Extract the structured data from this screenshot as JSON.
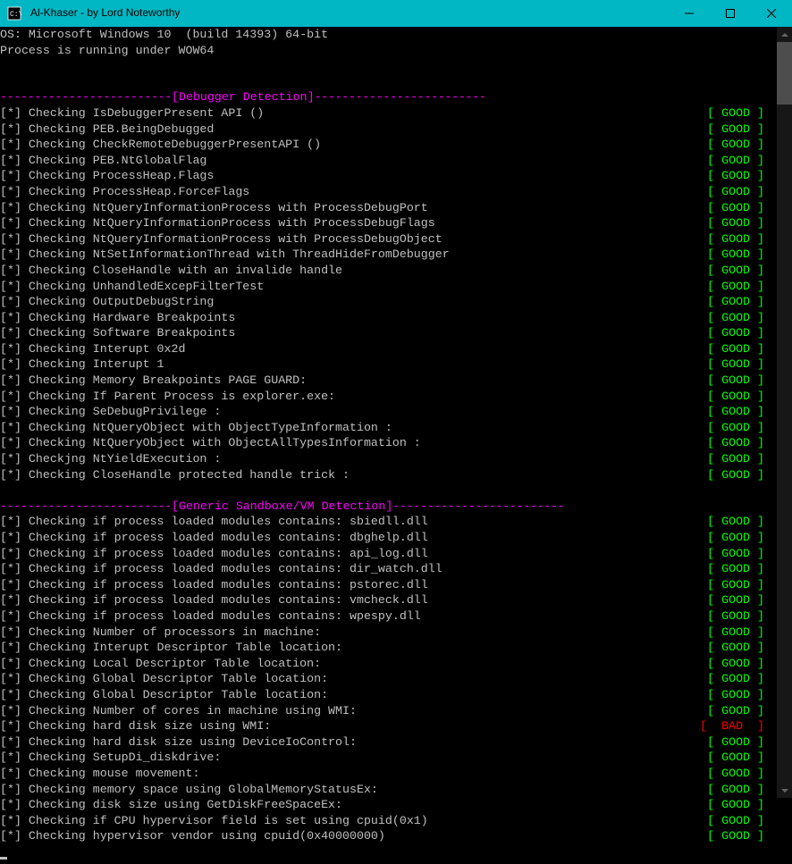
{
  "window": {
    "title": "Al-Khaser - by Lord Noteworthy"
  },
  "header_lines": [
    "OS: Microsoft Windows 10  (build 14393) 64-bit",
    "Process is running under WOW64"
  ],
  "sections": [
    {
      "title": "[Debugger Detection]",
      "dash_left": "-------------------------",
      "dash_right": "-------------------------",
      "items": [
        {
          "text": "Checking IsDebuggerPresent API ()",
          "status": "GOOD"
        },
        {
          "text": "Checking PEB.BeingDebugged",
          "status": "GOOD"
        },
        {
          "text": "Checking CheckRemoteDebuggerPresentAPI ()",
          "status": "GOOD"
        },
        {
          "text": "Checking PEB.NtGlobalFlag",
          "status": "GOOD"
        },
        {
          "text": "Checking ProcessHeap.Flags",
          "status": "GOOD"
        },
        {
          "text": "Checking ProcessHeap.ForceFlags",
          "status": "GOOD"
        },
        {
          "text": "Checking NtQueryInformationProcess with ProcessDebugPort",
          "status": "GOOD"
        },
        {
          "text": "Checking NtQueryInformationProcess with ProcessDebugFlags",
          "status": "GOOD"
        },
        {
          "text": "Checking NtQueryInformationProcess with ProcessDebugObject",
          "status": "GOOD"
        },
        {
          "text": "Checking NtSetInformationThread with ThreadHideFromDebugger",
          "status": "GOOD"
        },
        {
          "text": "Checking CloseHandle with an invalide handle",
          "status": "GOOD"
        },
        {
          "text": "Checking UnhandledExcepFilterTest",
          "status": "GOOD"
        },
        {
          "text": "Checking OutputDebugString",
          "status": "GOOD"
        },
        {
          "text": "Checking Hardware Breakpoints",
          "status": "GOOD"
        },
        {
          "text": "Checking Software Breakpoints",
          "status": "GOOD"
        },
        {
          "text": "Checking Interupt 0x2d",
          "status": "GOOD"
        },
        {
          "text": "Checking Interupt 1",
          "status": "GOOD"
        },
        {
          "text": "Checking Memory Breakpoints PAGE GUARD:",
          "status": "GOOD"
        },
        {
          "text": "Checking If Parent Process is explorer.exe:",
          "status": "GOOD"
        },
        {
          "text": "Checking SeDebugPrivilege :",
          "status": "GOOD"
        },
        {
          "text": "Checking NtQueryObject with ObjectTypeInformation :",
          "status": "GOOD"
        },
        {
          "text": "Checking NtQueryObject with ObjectAllTypesInformation :",
          "status": "GOOD"
        },
        {
          "text": "Checkjng NtYieldExecution :",
          "status": "GOOD"
        },
        {
          "text": "Checking CloseHandle protected handle trick :",
          "status": "GOOD"
        }
      ]
    },
    {
      "title": "[Generic Sandboxe/VM Detection]",
      "dash_left": "-------------------------",
      "dash_right": "-------------------------",
      "items": [
        {
          "text": "Checking if process loaded modules contains: sbiedll.dll",
          "status": "GOOD"
        },
        {
          "text": "Checking if process loaded modules contains: dbghelp.dll",
          "status": "GOOD"
        },
        {
          "text": "Checking if process loaded modules contains: api_log.dll",
          "status": "GOOD"
        },
        {
          "text": "Checking if process loaded modules contains: dir_watch.dll",
          "status": "GOOD"
        },
        {
          "text": "Checking if process loaded modules contains: pstorec.dll",
          "status": "GOOD"
        },
        {
          "text": "Checking if process loaded modules contains: vmcheck.dll",
          "status": "GOOD"
        },
        {
          "text": "Checking if process loaded modules contains: wpespy.dll",
          "status": "GOOD"
        },
        {
          "text": "Checking Number of processors in machine:",
          "status": "GOOD"
        },
        {
          "text": "Checking Interupt Descriptor Table location:",
          "status": "GOOD"
        },
        {
          "text": "Checking Local Descriptor Table location:",
          "status": "GOOD"
        },
        {
          "text": "Checking Global Descriptor Table location:",
          "status": "GOOD"
        },
        {
          "text": "Checking Global Descriptor Table location:",
          "status": "GOOD"
        },
        {
          "text": "Checking Number of cores in machine using WMI:",
          "status": "GOOD"
        },
        {
          "text": "Checking hard disk size using WMI:",
          "status": "BAD"
        },
        {
          "text": "Checking hard disk size using DeviceIoControl:",
          "status": "GOOD"
        },
        {
          "text": "Checking SetupDi_diskdrive:",
          "status": "GOOD"
        },
        {
          "text": "Checking mouse movement:",
          "status": "GOOD"
        },
        {
          "text": "Checking memory space using GlobalMemoryStatusEx:",
          "status": "GOOD"
        },
        {
          "text": "Checking disk size using GetDiskFreeSpaceEx:",
          "status": "GOOD"
        },
        {
          "text": "Checking if CPU hypervisor field is set using cpuid(0x1)",
          "status": "GOOD"
        },
        {
          "text": "Checking hypervisor vendor using cpuid(0x40000000)",
          "status": "GOOD"
        }
      ]
    }
  ],
  "bullet": "[*]",
  "status_fmt": {
    "l": "[ ",
    "r": " ]",
    "pad": true
  }
}
